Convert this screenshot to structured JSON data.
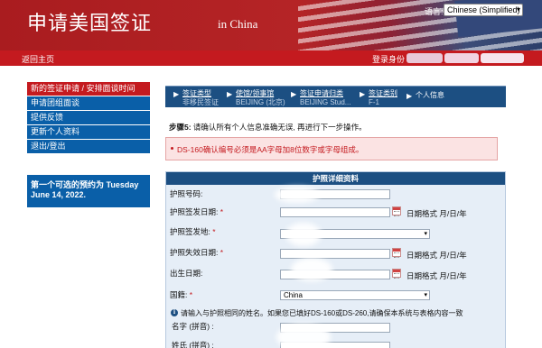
{
  "banner": {
    "title": "申请美国签证",
    "subtitle": "in China",
    "language_label": "语言:",
    "language_value": "Chinese (Simplified)"
  },
  "topnav": {
    "home_label": "返回主页",
    "login_label": "登录身份"
  },
  "sidebar": {
    "items": [
      {
        "label": "新的签证申请 / 安排面谈时间",
        "active": true
      },
      {
        "label": "申请团组面谈",
        "active": false
      },
      {
        "label": "提供反馈",
        "active": false
      },
      {
        "label": "更新个人资料",
        "active": false
      },
      {
        "label": "退出/登出",
        "active": false
      }
    ],
    "promo": "第一个可选的预约为 Tuesday June 14, 2022."
  },
  "breadcrumb": [
    {
      "step": "签证类型",
      "value": "非移民签证"
    },
    {
      "step": "使馆/领事馆",
      "value": "BEIJING (北京)"
    },
    {
      "step": "签证申请归类",
      "value": "BEIJING Stud..."
    },
    {
      "step": "签证类别",
      "value": "F-1"
    },
    {
      "step": "个人信息",
      "value": ""
    }
  ],
  "step_text": {
    "prefix": "步骤5:",
    "body": " 请确认所有个人信息准确无误, 再进行下一步操作。"
  },
  "error": {
    "message": "DS-160确认编号必须是AA字母加8位数字或字母组成。"
  },
  "passport": {
    "section_title": "护照详细资料",
    "fields": {
      "number": {
        "label": "护照号码:"
      },
      "issue_date": {
        "label": "护照签发日期:",
        "required": "*"
      },
      "issue_place": {
        "label": "护照签发地:",
        "required": "*"
      },
      "expiry_date": {
        "label": "护照失效日期:",
        "required": "*"
      },
      "birth_date": {
        "label": "出生日期:"
      },
      "nationality": {
        "label": "国籍:",
        "required": "*",
        "value": "China"
      }
    },
    "date_format": "日期格式 月/日/年",
    "info_icon": "i",
    "info_text": "请输入与护照相同的姓名。如果您已填好DS-160或DS-260,请确保本系统与表格内容一致",
    "given_name": {
      "label": "名字 (拼音) :"
    },
    "surname": {
      "label": "姓氏 (拼音) :"
    }
  },
  "colors": {
    "banner_red": "#b52426",
    "nav_red": "#c41a1f",
    "nav_blue": "#0a5fa8",
    "header_blue": "#1c4f82",
    "panel_bg": "#e6eef7",
    "error_bg": "#fbe3e3"
  }
}
